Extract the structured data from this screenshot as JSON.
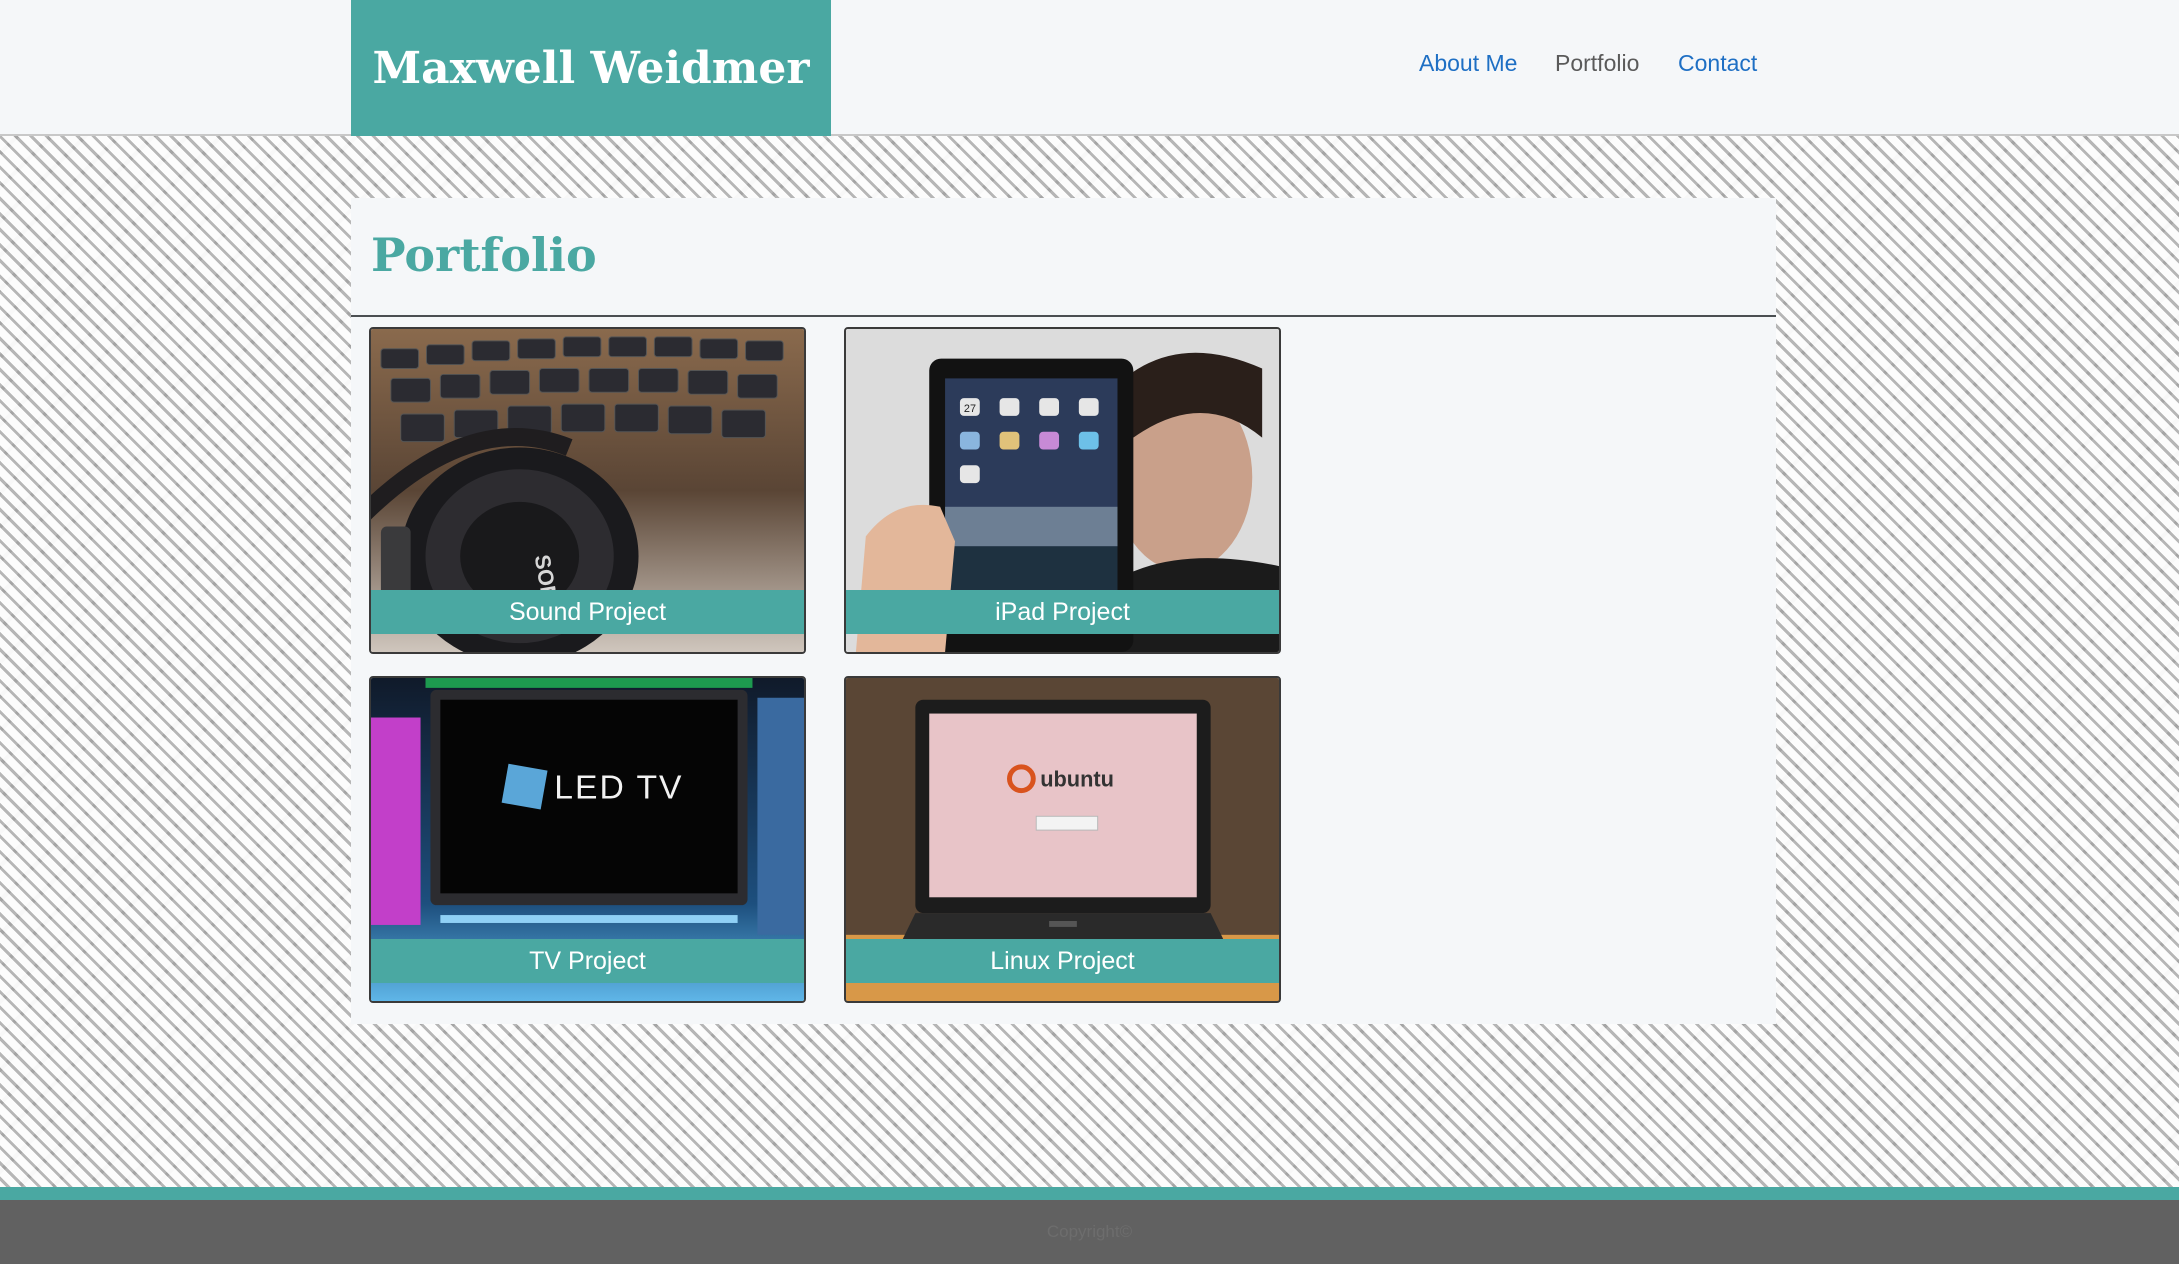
{
  "site": {
    "title": "Maxwell Weidmer"
  },
  "nav": [
    {
      "label": "About Me",
      "active": false
    },
    {
      "label": "Portfolio",
      "active": true
    },
    {
      "label": "Contact",
      "active": false
    }
  ],
  "main": {
    "heading": "Portfolio",
    "projects": [
      {
        "label": "Sound Project",
        "image": "headphones-keyboard-photo"
      },
      {
        "label": "iPad Project",
        "image": "ipad-photo"
      },
      {
        "label": "TV Project",
        "image": "led-tv-photo"
      },
      {
        "label": "Linux Project",
        "image": "ubuntu-laptop-photo"
      }
    ],
    "image_text": {
      "led_tv": "LED TV",
      "ubuntu": "ubuntu",
      "headphone_brand": "SONY",
      "calendar_date": "27"
    }
  },
  "footer": {
    "text": "Copyright©"
  },
  "colors": {
    "accent": "#4aa8a2",
    "link": "#1e6fc4",
    "active_link": "#5a5a5a",
    "header_bg": "#f5f7f9",
    "footer_bg": "#616161"
  }
}
